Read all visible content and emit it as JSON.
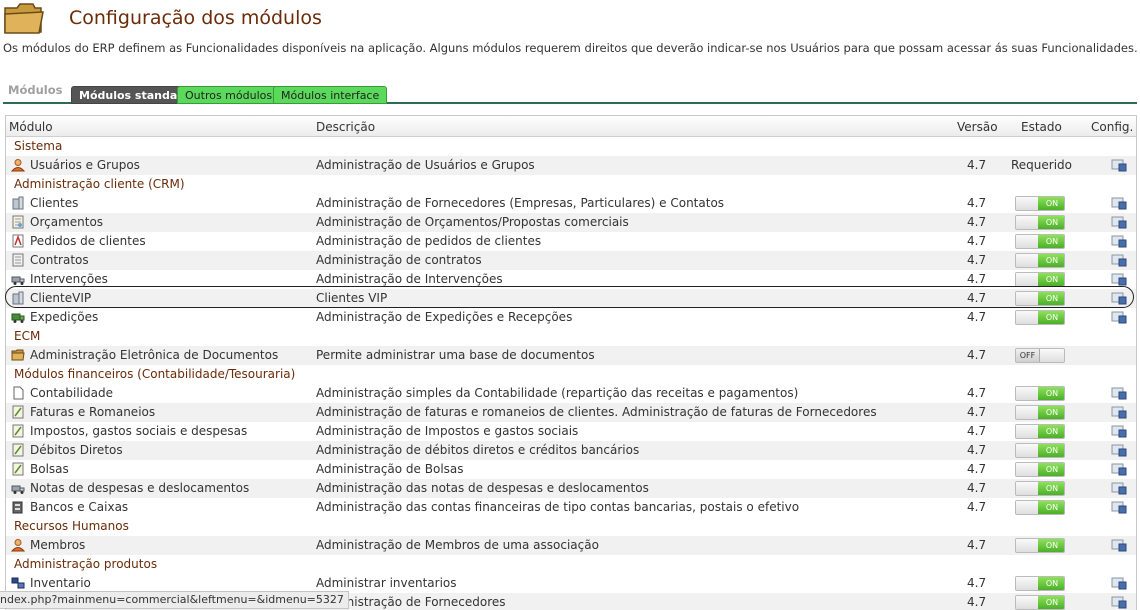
{
  "page": {
    "title": "Configuração dos módulos",
    "description": "Os módulos do ERP definem as Funcionalidades disponíveis na aplicação. Alguns módulos requerem direitos que deverão indicar-se nos Usuários para que possam acessar ás suas Funcionalidades."
  },
  "tabs": {
    "label": "Módulos",
    "items": [
      "Módulos standard",
      "Outros módulos",
      "Módulos interface"
    ]
  },
  "table": {
    "headers": {
      "module": "Módulo",
      "description": "Descrição",
      "version": "Versão",
      "state": "Estado",
      "config": "Config."
    },
    "toggle_on": "ON",
    "toggle_off": "OFF"
  },
  "sections": [
    {
      "label": "Sistema",
      "rows": [
        {
          "name": "Usuários e Grupos",
          "desc": "Administração de Usuários e Grupos",
          "ver": "4.7",
          "state": "Requerido",
          "icon": "users-icon"
        }
      ]
    },
    {
      "label": "Administração cliente (CRM)",
      "rows": [
        {
          "name": "Clientes",
          "desc": "Administração de Fornecedores (Empresas, Particulares) e Contatos",
          "ver": "4.7",
          "state": "on",
          "icon": "building-icon"
        },
        {
          "name": "Orçamentos",
          "desc": "Administração de Orçamentos/Propostas comerciais",
          "ver": "4.7",
          "state": "on",
          "icon": "document-icon"
        },
        {
          "name": "Pedidos de clientes",
          "desc": "Administração de pedidos de clientes",
          "ver": "4.7",
          "state": "on",
          "icon": "order-icon"
        },
        {
          "name": "Contratos",
          "desc": "Administração de contratos",
          "ver": "4.7",
          "state": "on",
          "icon": "contract-icon"
        },
        {
          "name": "Intervenções",
          "desc": "Administração de Intervenções",
          "ver": "4.7",
          "state": "on",
          "icon": "truck-icon"
        },
        {
          "name": "ClienteVIP",
          "desc": "Clientes VIP",
          "ver": "4.7",
          "state": "on",
          "icon": "building-icon"
        },
        {
          "name": "Expedições",
          "desc": "Administração de Expedições e Recepções",
          "ver": "4.7",
          "state": "on",
          "icon": "shipping-icon"
        }
      ]
    },
    {
      "label": "ECM",
      "rows": [
        {
          "name": "Administração Eletrônica de Documentos",
          "desc": "Permite administrar uma base de documentos",
          "ver": "4.7",
          "state": "off",
          "icon": "folder-icon"
        }
      ]
    },
    {
      "label": "Módulos financeiros (Contabilidade/Tesouraria)",
      "rows": [
        {
          "name": "Contabilidade",
          "desc": "Administração simples da Contabilidade (repartição das receitas e pagamentos)",
          "ver": "4.7",
          "state": "on",
          "icon": "page-icon"
        },
        {
          "name": "Faturas e Romaneios",
          "desc": "Administração de faturas e romaneios de clientes. Administração de faturas de Fornecedores",
          "ver": "4.7",
          "state": "on",
          "icon": "invoice-icon"
        },
        {
          "name": "Impostos, gastos sociais e despesas",
          "desc": "Administração de Impostos e gastos sociais",
          "ver": "4.7",
          "state": "on",
          "icon": "invoice-icon"
        },
        {
          "name": "Débitos Diretos",
          "desc": "Administração de débitos diretos e créditos bancários",
          "ver": "4.7",
          "state": "on",
          "icon": "invoice-icon"
        },
        {
          "name": "Bolsas",
          "desc": "Administração de Bolsas",
          "ver": "4.7",
          "state": "on",
          "icon": "invoice-icon"
        },
        {
          "name": "Notas de despesas e deslocamentos",
          "desc": "Administração das notas de despesas e deslocamentos",
          "ver": "4.7",
          "state": "on",
          "icon": "truck-icon"
        },
        {
          "name": "Bancos e Caixas",
          "desc": "Administração das contas financeiras de tipo contas bancarias, postais o efetivo",
          "ver": "4.7",
          "state": "on",
          "icon": "bank-icon"
        }
      ]
    },
    {
      "label": "Recursos Humanos",
      "rows": [
        {
          "name": "Membros",
          "desc": "Administração de Membros de uma associação",
          "ver": "4.7",
          "state": "on",
          "icon": "member-icon"
        }
      ]
    },
    {
      "label": "Administração produtos",
      "rows": [
        {
          "name": "Inventario",
          "desc": "Administrar inventarios",
          "ver": "4.7",
          "state": "on",
          "icon": "inventory-icon"
        },
        {
          "name": "",
          "desc": "Administração de Fornecedores",
          "ver": "4.7",
          "state": "on",
          "icon": ""
        }
      ]
    }
  ],
  "statusbar": {
    "url": "ndex.php?mainmenu=commercial&leftmenu=&idmenu=5327"
  }
}
